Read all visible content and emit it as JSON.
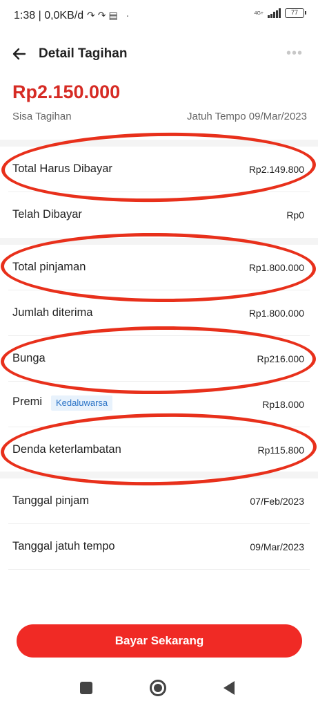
{
  "status_bar": {
    "time": "1:38 | 0,0KB/d",
    "notif_icons": "↷↷▤ ·",
    "network_type": "4G+",
    "battery": "77"
  },
  "header": {
    "title": "Detail Tagihan",
    "back_icon": "arrow-left-icon",
    "more_icon": "more-horizontal-icon"
  },
  "summary": {
    "amount": "Rp2.150.000",
    "label": "Sisa Tagihan",
    "due": "Jatuh Tempo 09/Mar/2023"
  },
  "sections": {
    "payment": [
      {
        "label": "Total Harus Dibayar",
        "value": "Rp2.149.800"
      },
      {
        "label": "Telah Dibayar",
        "value": "Rp0"
      }
    ],
    "loan": [
      {
        "label": "Total pinjaman",
        "value": "Rp1.800.000"
      },
      {
        "label": "Jumlah diterima",
        "value": "Rp1.800.000"
      },
      {
        "label": "Bunga",
        "value": "Rp216.000"
      },
      {
        "label": "Premi",
        "badge": "Kedaluwarsa",
        "value": "Rp18.000"
      },
      {
        "label": "Denda keterlambatan",
        "value": "Rp115.800"
      }
    ],
    "dates": [
      {
        "label": "Tanggal pinjam",
        "value": "07/Feb/2023"
      },
      {
        "label": "Tanggal jatuh tempo",
        "value": "09/Mar/2023"
      }
    ]
  },
  "pay_button": {
    "label": "Bayar Sekarang"
  },
  "colors": {
    "accent": "#d62b24",
    "button": "#f02a25",
    "annotation": "#e8301b",
    "badge_text": "#2a73c6"
  }
}
